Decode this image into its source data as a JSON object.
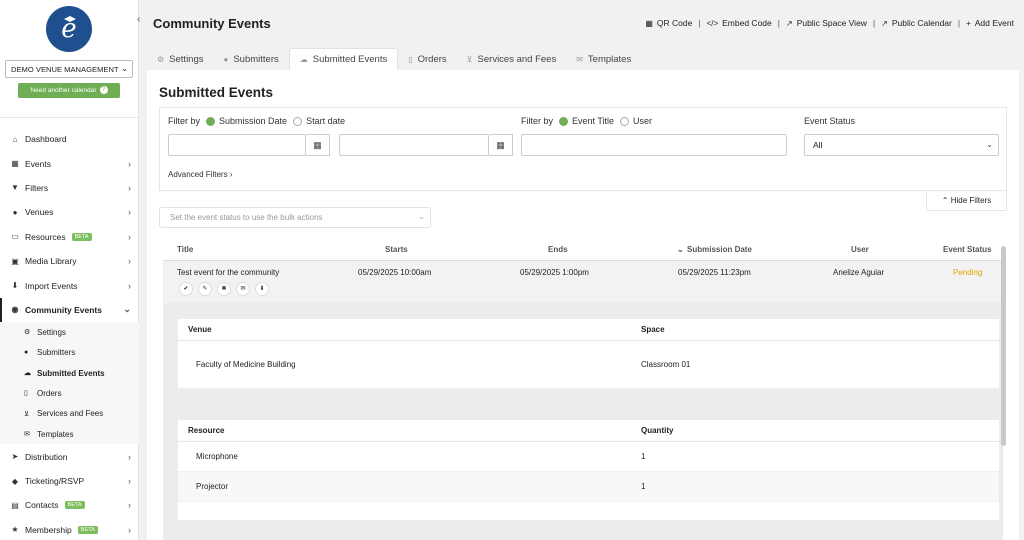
{
  "sidebar": {
    "venue_select": "DEMO VENUE MANAGEMENT",
    "need_calendar": "Need another calendar",
    "items": [
      {
        "label": "Dashboard",
        "icon": "home-icon",
        "arrow": false
      },
      {
        "label": "Events",
        "icon": "calendar-icon",
        "arrow": true
      },
      {
        "label": "Filters",
        "icon": "filter-icon",
        "arrow": true
      },
      {
        "label": "Venues",
        "icon": "map-pin-icon",
        "arrow": true
      },
      {
        "label": "Resources",
        "icon": "monitor-icon",
        "arrow": true,
        "badge": "BETA"
      },
      {
        "label": "Media Library",
        "icon": "image-icon",
        "arrow": true
      },
      {
        "label": "Import Events",
        "icon": "import-icon",
        "arrow": true
      }
    ],
    "community": {
      "label": "Community Events",
      "icon": "globe-icon"
    },
    "sub_items": [
      {
        "label": "Settings",
        "icon": "gears-icon"
      },
      {
        "label": "Submitters",
        "icon": "users-icon"
      },
      {
        "label": "Submitted Events",
        "icon": "cloud-upload-icon"
      },
      {
        "label": "Orders",
        "icon": "document-icon"
      },
      {
        "label": "Services and Fees",
        "icon": "cart-icon"
      },
      {
        "label": "Templates",
        "icon": "envelope-icon"
      }
    ],
    "bottom_items": [
      {
        "label": "Distribution",
        "icon": "share-icon",
        "arrow": true
      },
      {
        "label": "Ticketing/RSVP",
        "icon": "ticket-icon",
        "arrow": true
      },
      {
        "label": "Contacts",
        "icon": "address-card-icon",
        "arrow": true,
        "badge": "BETA"
      },
      {
        "label": "Membership",
        "icon": "star-icon",
        "arrow": true,
        "badge": "BETA"
      }
    ]
  },
  "header": {
    "title": "Community Events",
    "links": [
      {
        "label": "QR Code",
        "icon": "qr-icon"
      },
      {
        "label": "Embed Code",
        "icon": "code-icon"
      },
      {
        "label": "Public Space View",
        "icon": "external-link-icon"
      },
      {
        "label": "Public Calendar",
        "icon": "external-link-icon"
      },
      {
        "label": "Add Event",
        "icon": "plus-icon"
      }
    ]
  },
  "tabs": [
    {
      "label": "Settings",
      "icon": "gear-icon"
    },
    {
      "label": "Submitters",
      "icon": "users-icon"
    },
    {
      "label": "Submitted Events",
      "icon": "cloud-upload-icon",
      "active": true
    },
    {
      "label": "Orders",
      "icon": "document-icon"
    },
    {
      "label": "Services and Fees",
      "icon": "cart-icon"
    },
    {
      "label": "Templates",
      "icon": "envelope-icon"
    }
  ],
  "main": {
    "section_title": "Submitted Events",
    "filter_by_label": "Filter by",
    "date_options": [
      "Submission Date",
      "Start date"
    ],
    "filter_by_label_2": "Filter by",
    "title_options": [
      "Event Title",
      "User"
    ],
    "status_label": "Event Status",
    "status_value": "All",
    "advanced_filters": "Advanced Filters",
    "hide_filters": "Hide Filters",
    "bulk_placeholder": "Set the event status to use the bulk actions"
  },
  "table": {
    "columns": [
      "Title",
      "Starts",
      "Ends",
      "Submission Date",
      "User",
      "Event Status"
    ],
    "rows": [
      {
        "title": "Test event for the community",
        "starts": "05/29/2025 10:00am",
        "ends": "05/29/2025 1:00pm",
        "submitted": "05/29/2025 11:23pm",
        "user": "Anelize Aguiar",
        "status": "Pending"
      }
    ]
  },
  "details": {
    "venue_header": "Venue",
    "space_header": "Space",
    "venue": "Faculty of Medicine Building",
    "space": "Classroom 01",
    "resource_header": "Resource",
    "quantity_header": "Quantity",
    "resources": [
      {
        "name": "Microphone",
        "qty": "1"
      },
      {
        "name": "Projector",
        "qty": "1"
      }
    ]
  },
  "colors": {
    "accent": "#6fae55",
    "pending": "#e0a800",
    "logo": "#1f4f8f"
  }
}
